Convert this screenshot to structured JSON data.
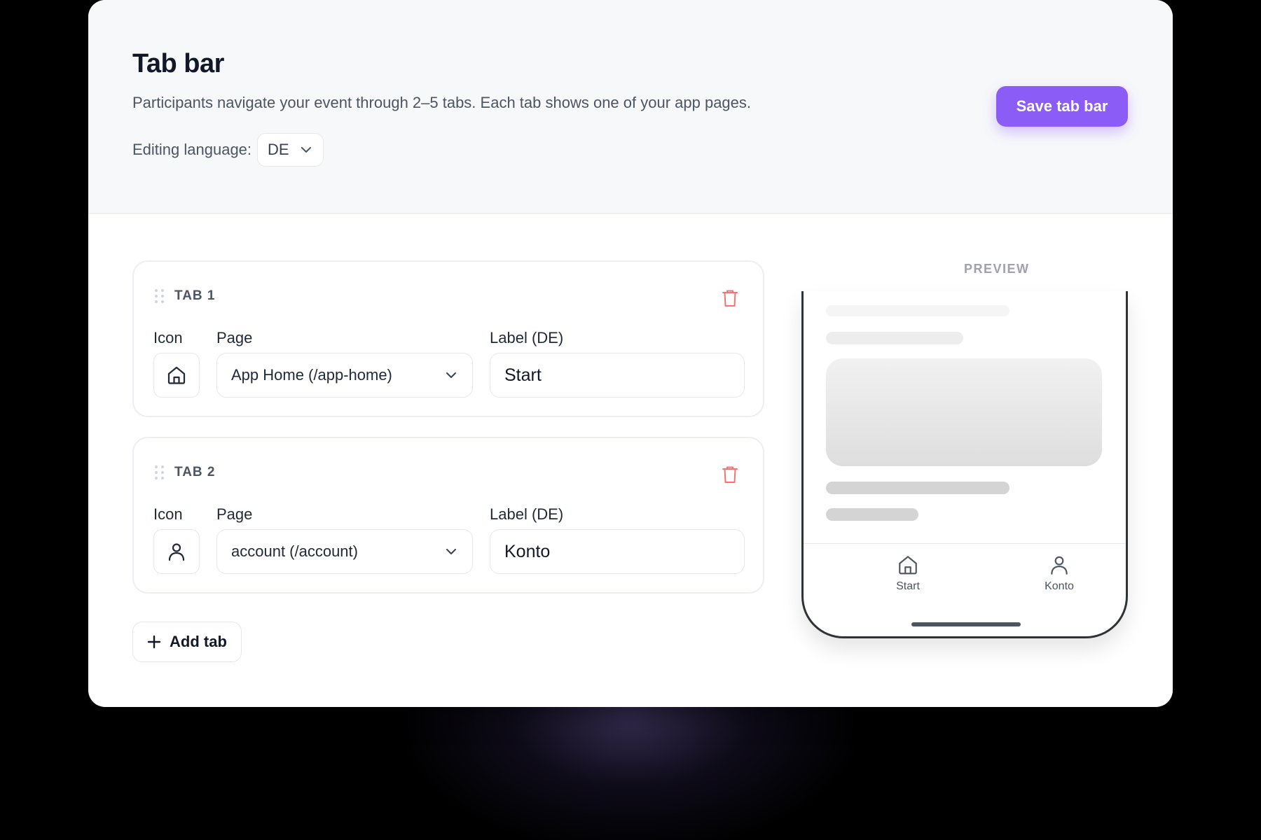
{
  "header": {
    "title": "Tab bar",
    "description": "Participants navigate your event through 2–5 tabs. Each tab shows one of your app pages.",
    "editing_language_label": "Editing language:",
    "editing_language_value": "DE",
    "save_label": "Save tab bar"
  },
  "tabs": [
    {
      "title": "TAB 1",
      "icon_label": "Icon",
      "page_label": "Page",
      "label_label": "Label (DE)",
      "icon": "home-icon",
      "page_value": "App Home (/app-home)",
      "label_value": "Start"
    },
    {
      "title": "TAB 2",
      "icon_label": "Icon",
      "page_label": "Page",
      "label_label": "Label (DE)",
      "icon": "user-icon",
      "page_value": "account (/account)",
      "label_value": "Konto"
    }
  ],
  "add_tab_label": "Add tab",
  "preview": {
    "label": "PREVIEW",
    "tabbar": [
      {
        "icon": "home-icon",
        "label": "Start"
      },
      {
        "icon": "user-icon",
        "label": "Konto"
      }
    ]
  },
  "colors": {
    "accent": "#8b5cf6",
    "delete": "#f87171",
    "text_primary": "#111827",
    "text_secondary": "#4b5563"
  }
}
